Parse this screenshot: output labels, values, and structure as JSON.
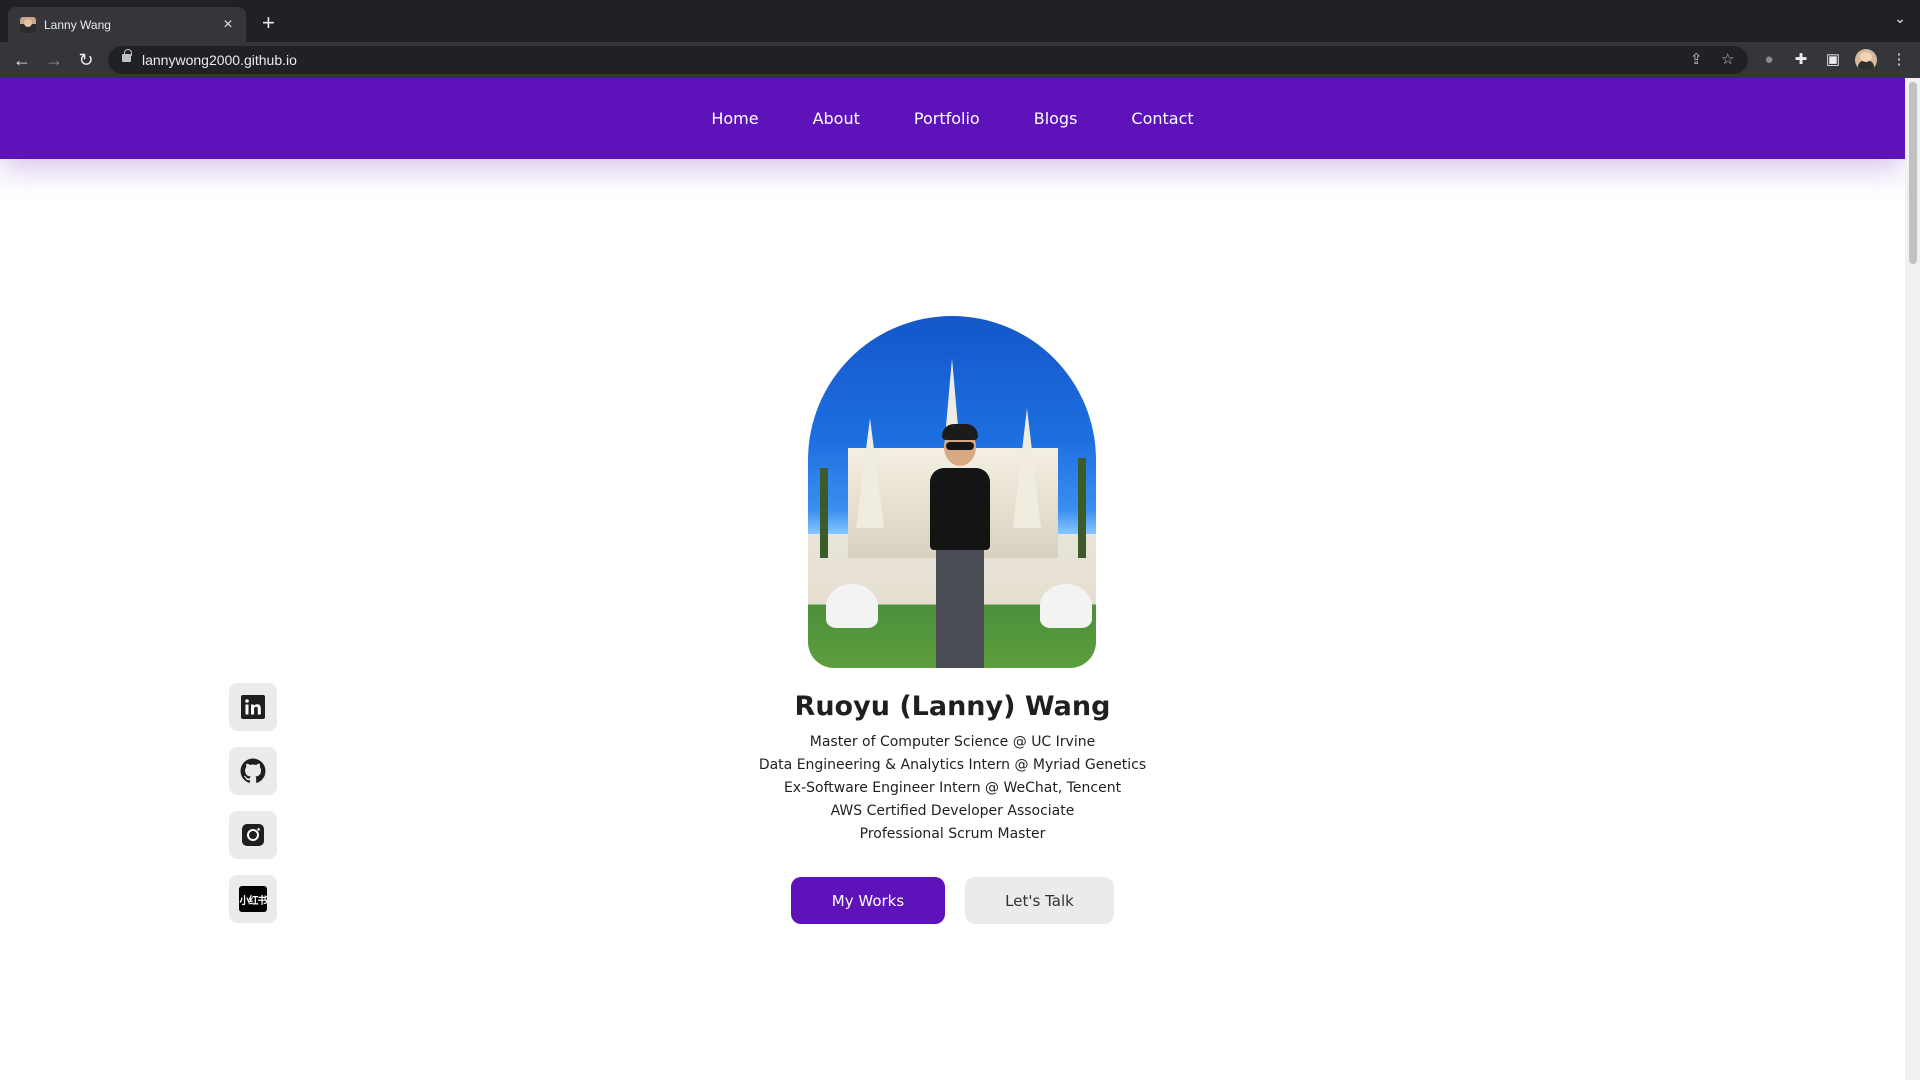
{
  "browser": {
    "tab_title": "Lanny Wang",
    "tab_close": "×",
    "new_tab": "+",
    "tab_search": "⌄",
    "url": "lannywong2000.github.io"
  },
  "nav": {
    "items": [
      "Home",
      "About",
      "Portfolio",
      "Blogs",
      "Contact"
    ]
  },
  "hero": {
    "name": "Ruoyu (Lanny) Wang",
    "lines": [
      "Master of Computer Science @ UC Irvine",
      "Data Engineering & Analytics Intern @ Myriad Genetics",
      "Ex-Software Engineer Intern @ WeChat, Tencent",
      "AWS Certified Developer Associate",
      "Professional Scrum Master"
    ],
    "primary_button": "My Works",
    "secondary_button": "Let's Talk"
  },
  "socials": {
    "icons": [
      "linkedin-icon",
      "github-icon",
      "instagram-icon",
      "xiaohongshu-icon"
    ],
    "xiaohongshu_label": "小红书"
  },
  "colors": {
    "brand": "#5e12ba",
    "secondary_button": "#ebebeb",
    "chrome_dark": "#202124",
    "chrome_toolbar": "#35363a"
  }
}
